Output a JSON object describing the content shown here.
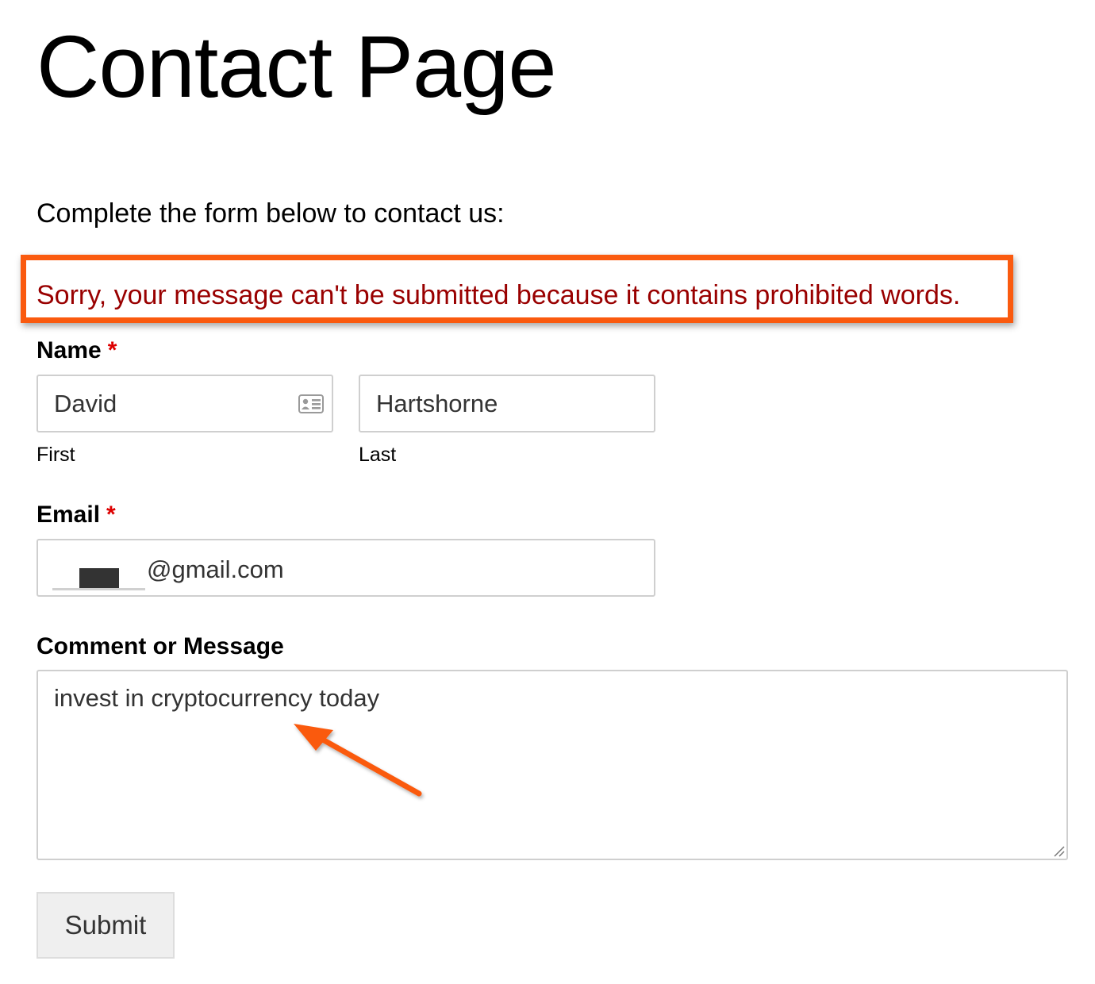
{
  "page": {
    "title": "Contact Page",
    "intro": "Complete the form below to contact us:"
  },
  "error": {
    "message": "Sorry, your message can't be submitted because it contains prohibited words.",
    "highlight_color": "#fa5a0f",
    "text_color": "#990000"
  },
  "form": {
    "name": {
      "label": "Name",
      "required_mark": "*",
      "first": {
        "value": "David",
        "sublabel": "First",
        "icon": "contact-card-icon"
      },
      "last": {
        "value": "Hartshorne",
        "sublabel": "Last"
      }
    },
    "email": {
      "label": "Email",
      "required_mark": "*",
      "value_visible": "@gmail.com"
    },
    "message": {
      "label": "Comment or Message",
      "value": "invest in cryptocurrency today"
    },
    "submit": {
      "label": "Submit"
    }
  },
  "annotation": {
    "arrow_color": "#fa5a0f",
    "icon": "arrow-icon"
  }
}
